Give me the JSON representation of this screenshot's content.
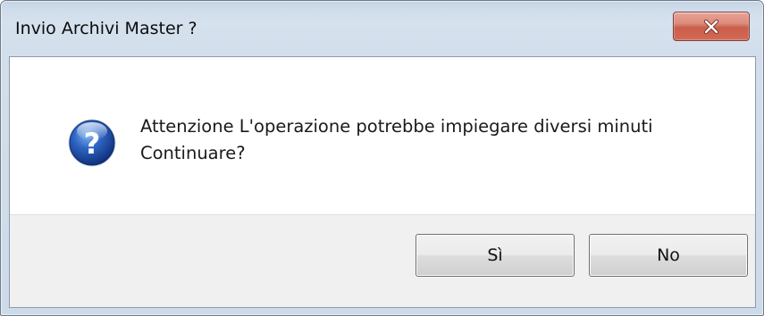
{
  "window": {
    "title": "Invio Archivi Master ?"
  },
  "message": {
    "line1": "Attenzione L'operazione potrebbe impiegare diversi minuti",
    "line2": "Continuare?"
  },
  "icons": {
    "dialog": "question-icon",
    "close": "close-icon"
  },
  "buttons": {
    "yes_label": "Sì",
    "no_label": "No"
  },
  "colors": {
    "close_button": "#c95d49",
    "icon_blue": "#1f4fa3",
    "button_bar": "#f0f0f0"
  }
}
